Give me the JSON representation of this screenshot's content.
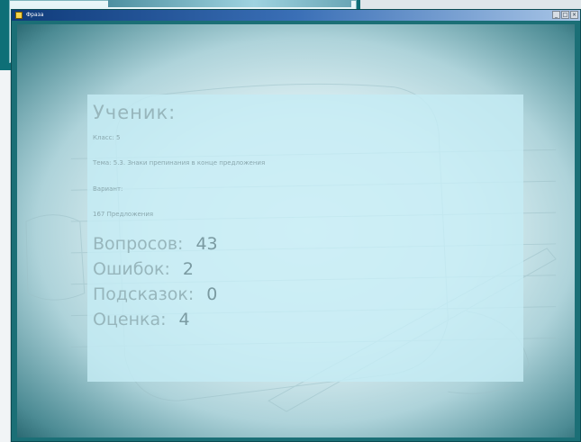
{
  "window": {
    "title": "Фраза",
    "controls": [
      "_",
      "□",
      "×"
    ]
  },
  "result": {
    "student_label": "Ученик:",
    "class_line": "Класс: 5",
    "topic_line": "Тема: 5.3. Знаки препинания в конце предложения",
    "variant_line": "Вариант:",
    "lesson_line": "167 Предложения",
    "questions_label": "Вопросов:",
    "questions_value": "43",
    "errors_label": "Ошибок:",
    "errors_value": "2",
    "hints_label": "Подсказок:",
    "hints_value": "0",
    "grade_label": "Оценка:",
    "grade_value": "4"
  },
  "colors": {
    "frame": "#1b6f76",
    "panel": "#c4ecf4",
    "text": "#97b6bc"
  }
}
